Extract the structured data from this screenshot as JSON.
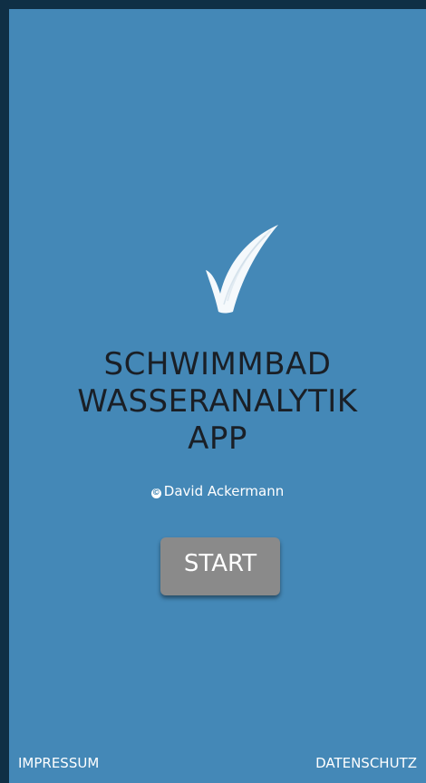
{
  "app": {
    "title_lines": [
      "SCHWIMMBAD",
      "WASSERANALYTIK",
      "APP"
    ],
    "copyright_symbol": "©",
    "copyright_text": "David Ackermann",
    "logo_icon": "checkmark-icon"
  },
  "actions": {
    "start_label": "START"
  },
  "footer": {
    "impressum_label": "IMPRESSUM",
    "datenschutz_label": "DATENSCHUTZ"
  },
  "colors": {
    "background": "#4488b7",
    "frame": "#0f2f45",
    "title_text": "#1a1f26",
    "button": "#8a8a8a",
    "light_text": "#ffffff"
  }
}
